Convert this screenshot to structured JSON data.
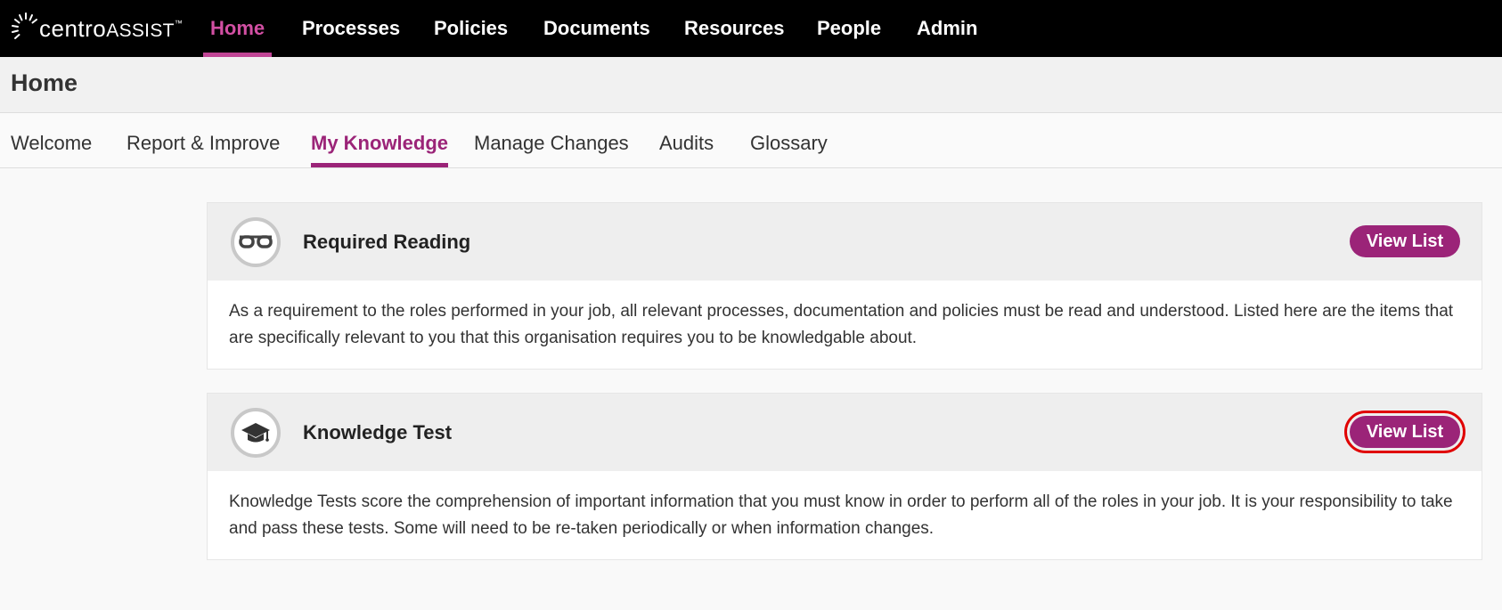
{
  "app": {
    "logo": {
      "primary": "centro",
      "secondary": "ASSIST",
      "trademark": "™"
    }
  },
  "topnav": {
    "items": [
      {
        "label": "Home",
        "active": true
      },
      {
        "label": "Processes"
      },
      {
        "label": "Policies"
      },
      {
        "label": "Documents"
      },
      {
        "label": "Resources"
      },
      {
        "label": "People"
      },
      {
        "label": "Admin"
      }
    ]
  },
  "page": {
    "title": "Home"
  },
  "subnav": {
    "tabs": [
      {
        "label": "Welcome"
      },
      {
        "label": "Report & Improve"
      },
      {
        "label": "My Knowledge",
        "active": true
      },
      {
        "label": "Manage Changes"
      },
      {
        "label": "Audits"
      },
      {
        "label": "Glossary"
      }
    ]
  },
  "cards": [
    {
      "title": "Required Reading",
      "icon": "glasses-icon",
      "button_label": "View List",
      "description": "As a requirement to the roles performed in your job, all relevant processes, documentation and policies must be read and understood. Listed here are the items that are specifically relevant to you that this organisation requires you to be knowledgable about."
    },
    {
      "title": "Knowledge Test",
      "icon": "graduation-cap-icon",
      "button_label": "View List",
      "highlighted": true,
      "description": "Knowledge Tests score the comprehension of important information that you must know in order to perform all of the roles in your job. It is your responsibility to take and pass these tests. Some will need to be re-taken periodically or when information changes."
    }
  ],
  "colors": {
    "brand": "#9b2478",
    "active_nav": "#d24fa3",
    "topbar": "#000000",
    "highlight_box": "#e00000"
  }
}
